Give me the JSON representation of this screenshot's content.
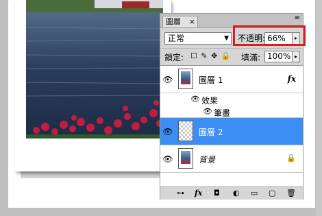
{
  "panel": {
    "tab_label": "圖層",
    "tab_close": "×",
    "menu_icon": "≡"
  },
  "blend_mode": {
    "value": "正常",
    "arrow": "▼"
  },
  "opacity": {
    "label": "不透明:",
    "value": "66%",
    "arrow": "▸"
  },
  "lock": {
    "label": "鎖定:",
    "icons": "☐ ✎ ✥ 🔒"
  },
  "fill": {
    "label": "填滿:",
    "value": "100%",
    "arrow": "▸"
  },
  "layers": [
    {
      "name": "圖層 1",
      "fx": "fx",
      "eye": "👁",
      "selected": false
    },
    {
      "name": "效果",
      "eye": "👁",
      "type": "effects-group"
    },
    {
      "name": "筆畫",
      "eye": "👁",
      "type": "effect"
    },
    {
      "name": "圖層 2",
      "eye": "👁",
      "selected": true
    },
    {
      "name": "背景",
      "eye": "👁",
      "locked": true,
      "lock_icon": "🔒"
    }
  ],
  "bottom_icons": [
    "⊶",
    "fx",
    "◘",
    "◐",
    "▭",
    "▢",
    "🗑"
  ],
  "colors": {
    "selected_row": "#3d8ef3",
    "highlight_box": "#d81e1e"
  }
}
